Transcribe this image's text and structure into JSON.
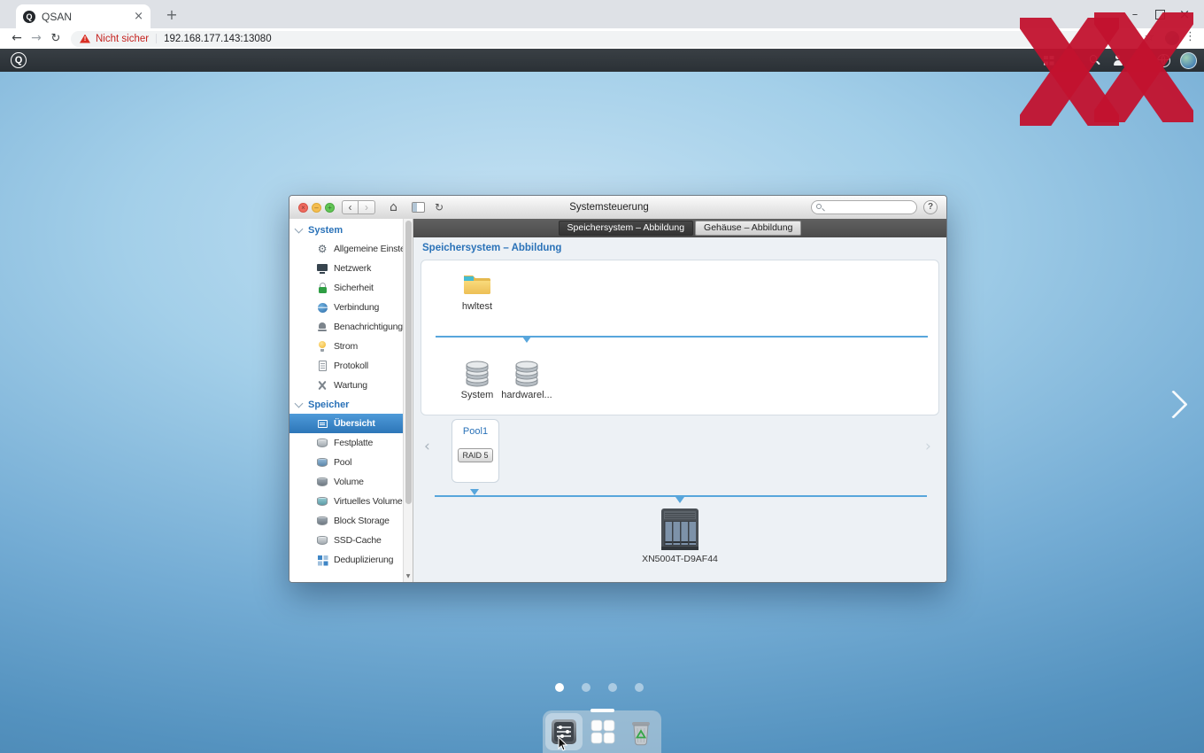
{
  "browser": {
    "tab_title": "QSAN",
    "favicon_letter": "Q",
    "not_secure": "Nicht sicher",
    "url": "192.168.177.143:13080"
  },
  "topbar": {
    "logo_letter": "Q"
  },
  "window": {
    "title": "Systemsteuerung",
    "help_label": "?",
    "tabs": [
      {
        "label": "Speichersystem – Abbildung"
      },
      {
        "label": "Gehäuse – Abbildung"
      }
    ],
    "sidebar": {
      "sections": [
        {
          "title": "System",
          "items": [
            {
              "label": "Allgemeine Einstell..."
            },
            {
              "label": "Netzwerk"
            },
            {
              "label": "Sicherheit"
            },
            {
              "label": "Verbindung"
            },
            {
              "label": "Benachrichtigung"
            },
            {
              "label": "Strom"
            },
            {
              "label": "Protokoll"
            },
            {
              "label": "Wartung"
            }
          ]
        },
        {
          "title": "Speicher",
          "items": [
            {
              "label": "Übersicht"
            },
            {
              "label": "Festplatte"
            },
            {
              "label": "Pool"
            },
            {
              "label": "Volume"
            },
            {
              "label": "Virtuelles Volume"
            },
            {
              "label": "Block Storage"
            },
            {
              "label": "SSD-Cache"
            },
            {
              "label": "Deduplizierung"
            }
          ]
        }
      ]
    },
    "content": {
      "heading": "Speichersystem – Abbildung",
      "folder_label": "hwltest",
      "disks": [
        {
          "label": "System"
        },
        {
          "label": "hardwarel..."
        }
      ],
      "pool": {
        "name": "Pool1",
        "raid": "RAID 5"
      },
      "device_label": "XN5004T-D9AF44"
    }
  }
}
